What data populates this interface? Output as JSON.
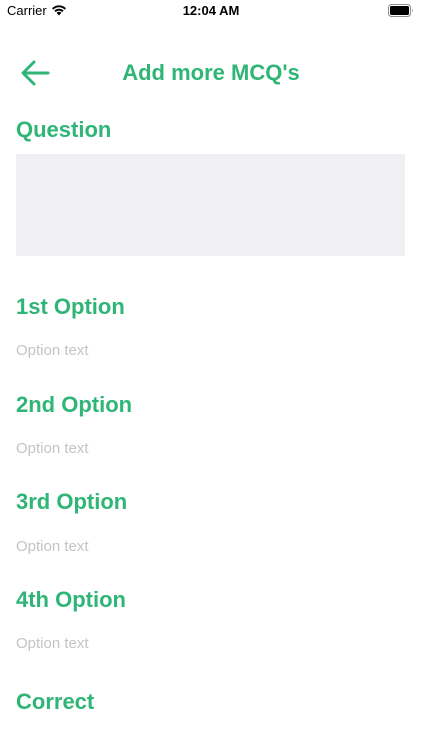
{
  "status_bar": {
    "carrier": "Carrier",
    "time": "12:04 AM"
  },
  "nav": {
    "title": "Add more MCQ's",
    "back_icon": "arrow-left-icon"
  },
  "question": {
    "label": "Question",
    "value": ""
  },
  "options": [
    {
      "label": "1st Option",
      "placeholder": "Option text",
      "value": ""
    },
    {
      "label": "2nd Option",
      "placeholder": "Option text",
      "value": ""
    },
    {
      "label": "3rd Option",
      "placeholder": "Option text",
      "value": ""
    },
    {
      "label": "4th Option",
      "placeholder": "Option text",
      "value": ""
    }
  ],
  "correct": {
    "label": "Correct"
  },
  "colors": {
    "accent": "#2fb576",
    "placeholder": "#c4c4c6",
    "input_background": "#efeff4"
  }
}
